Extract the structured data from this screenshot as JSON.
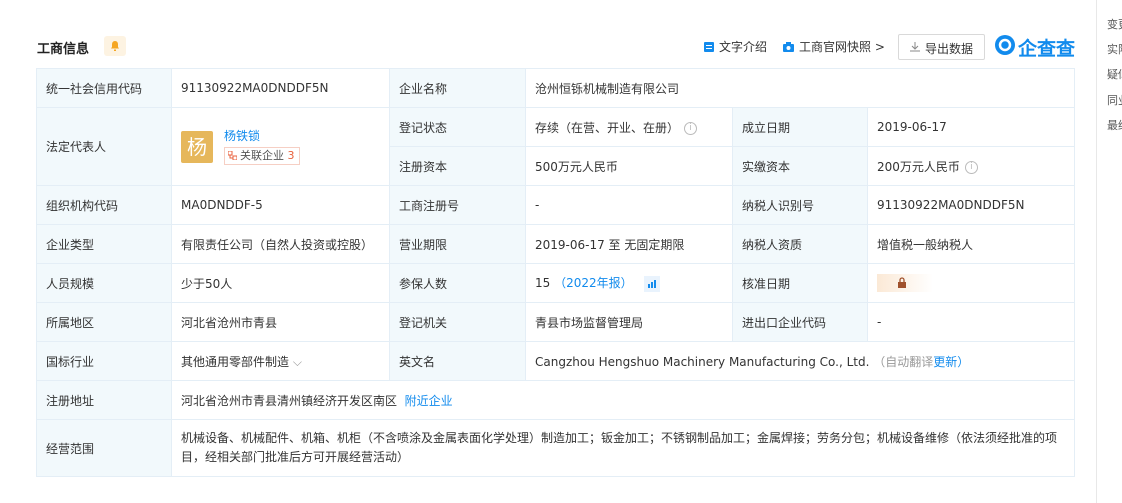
{
  "header": {
    "title": "工商信息",
    "links": {
      "text_intro": "文字介绍",
      "official_snapshot": "工商官网快照",
      "export": "导出数据"
    },
    "logo_text": "企查查"
  },
  "right_sidebar": [
    "变更",
    "实际",
    "疑似",
    "同业",
    "最终"
  ],
  "labels": {
    "credit_code": "统一社会信用代码",
    "company_name": "企业名称",
    "legal_rep": "法定代表人",
    "reg_status": "登记状态",
    "founded": "成立日期",
    "reg_capital": "注册资本",
    "paid_capital": "实缴资本",
    "org_code": "组织机构代码",
    "reg_no": "工商注册号",
    "taxpayer_id": "纳税人识别号",
    "company_type": "企业类型",
    "term": "营业期限",
    "taxpayer_qual": "纳税人资质",
    "staff_size": "人员规模",
    "insured": "参保人数",
    "approval_date": "核准日期",
    "region": "所属地区",
    "reg_authority": "登记机关",
    "ie_code": "进出口企业代码",
    "industry": "国标行业",
    "english_name": "英文名",
    "reg_address": "注册地址",
    "business_scope": "经营范围"
  },
  "values": {
    "credit_code": "91130922MA0DNDDF5N",
    "company_name": "沧州恒铄机械制造有限公司",
    "legal_rep_avatar": "杨",
    "legal_rep_name": "杨铁锁",
    "related_label": "关联企业",
    "related_count": "3",
    "reg_status": "存续（在营、开业、在册）",
    "founded": "2019-06-17",
    "reg_capital": "500万元人民币",
    "paid_capital": "200万元人民币",
    "org_code": "MA0DNDDF-5",
    "reg_no": "-",
    "taxpayer_id": "91130922MA0DNDDF5N",
    "company_type": "有限责任公司（自然人投资或控股）",
    "term": "2019-06-17 至 无固定期限",
    "taxpayer_qual": "增值税一般纳税人",
    "staff_size": "少于50人",
    "insured_count": "15",
    "insured_year": "（2022年报）",
    "region": "河北省沧州市青县",
    "reg_authority": "青县市场监督管理局",
    "ie_code": "-",
    "industry": "其他通用零部件制造",
    "english_name": "Cangzhou Hengshuo Machinery Manufacturing Co., Ltd.",
    "auto_translate": "（自动翻译",
    "update": "更新）",
    "reg_address": "河北省沧州市青县清州镇经济开发区南区",
    "nearby": "附近企业",
    "business_scope": "机械设备、机械配件、机箱、机柜（不含喷涂及金属表面化学处理）制造加工；钣金加工；不锈钢制品加工；金属焊接；劳务分包；机械设备维修（依法须经批准的项目，经相关部门批准后方可开展经营活动）"
  },
  "icons": [
    "bell-icon",
    "doc-icon",
    "camera-icon",
    "chevron-right-icon",
    "download-icon",
    "info-icon",
    "lock-icon",
    "chart-icon",
    "chevron-down-icon",
    "link-icon"
  ],
  "colors": {
    "accent": "#128bed",
    "label_bg": "#f2f9fc",
    "avatar": "#e6b75b"
  }
}
